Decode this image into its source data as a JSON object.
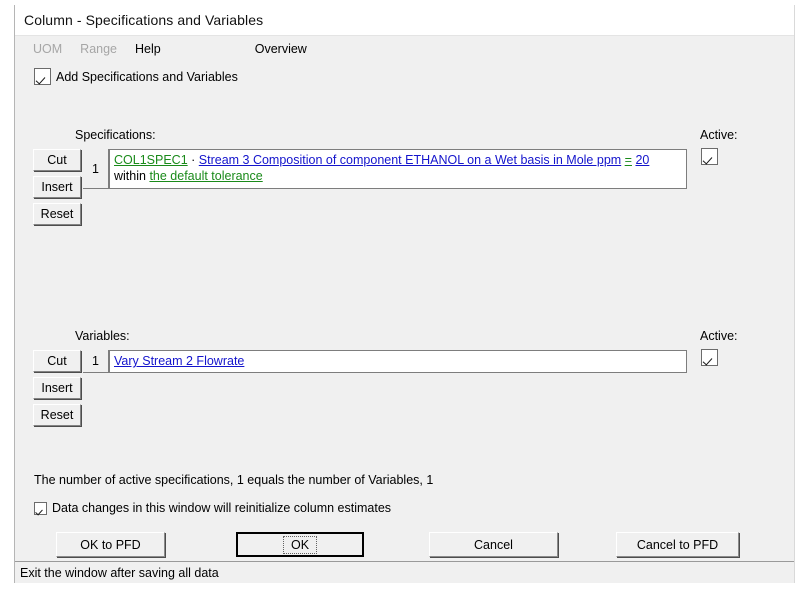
{
  "window": {
    "title": "Column - Specifications and Variables"
  },
  "menubar": {
    "items": [
      {
        "label": "UOM",
        "enabled": false
      },
      {
        "label": "Range",
        "enabled": false
      },
      {
        "label": "Help",
        "enabled": true
      },
      {
        "label": "Overview",
        "enabled": true
      }
    ]
  },
  "add_specs_checkbox": {
    "label": "Add Specifications and Variables",
    "checked": true
  },
  "specifications": {
    "caption": "Specifications:",
    "active_caption": "Active:",
    "buttons": {
      "cut": "Cut",
      "insert": "Insert",
      "reset": "Reset"
    },
    "rows": [
      {
        "number": "1",
        "active": true,
        "fragments": [
          {
            "text": "COL1SPEC1",
            "color": "green",
            "link": true
          },
          {
            "text": "  ·  ",
            "color": "black",
            "link": false
          },
          {
            "text": "Stream 3 Composition of component ETHANOL on a Wet basis in Mole ppm",
            "color": "blue",
            "link": true
          },
          {
            "text": " ",
            "color": "black",
            "link": false
          },
          {
            "text": "=",
            "color": "green",
            "link": true
          },
          {
            "text": " ",
            "color": "black",
            "link": false
          },
          {
            "text": "20",
            "color": "blue",
            "link": true
          },
          {
            "text": " within ",
            "color": "black",
            "link": false
          },
          {
            "text": "the default tolerance",
            "color": "green",
            "link": true
          }
        ]
      }
    ]
  },
  "variables": {
    "caption": "Variables:",
    "active_caption": "Active:",
    "buttons": {
      "cut": "Cut",
      "insert": "Insert",
      "reset": "Reset"
    },
    "rows": [
      {
        "number": "1",
        "active": true,
        "fragments": [
          {
            "text": "Vary Stream 2 Flowrate",
            "color": "blue",
            "link": true
          }
        ]
      }
    ]
  },
  "summary": {
    "text": "The number of active specifications, 1 equals the number of Variables, 1"
  },
  "reinit_checkbox": {
    "label": "Data changes in this window will reinitialize column estimates",
    "checked": true
  },
  "buttons": {
    "ok_to_pfd": "OK to PFD",
    "ok": "OK",
    "cancel": "Cancel",
    "cancel_to_pfd": "Cancel to PFD"
  },
  "statusbar": {
    "text": "Exit the window after saving all data"
  },
  "colors": {
    "link_green": "#1a8a1a",
    "link_blue": "#1414cc",
    "face": "#f0f0f0"
  }
}
